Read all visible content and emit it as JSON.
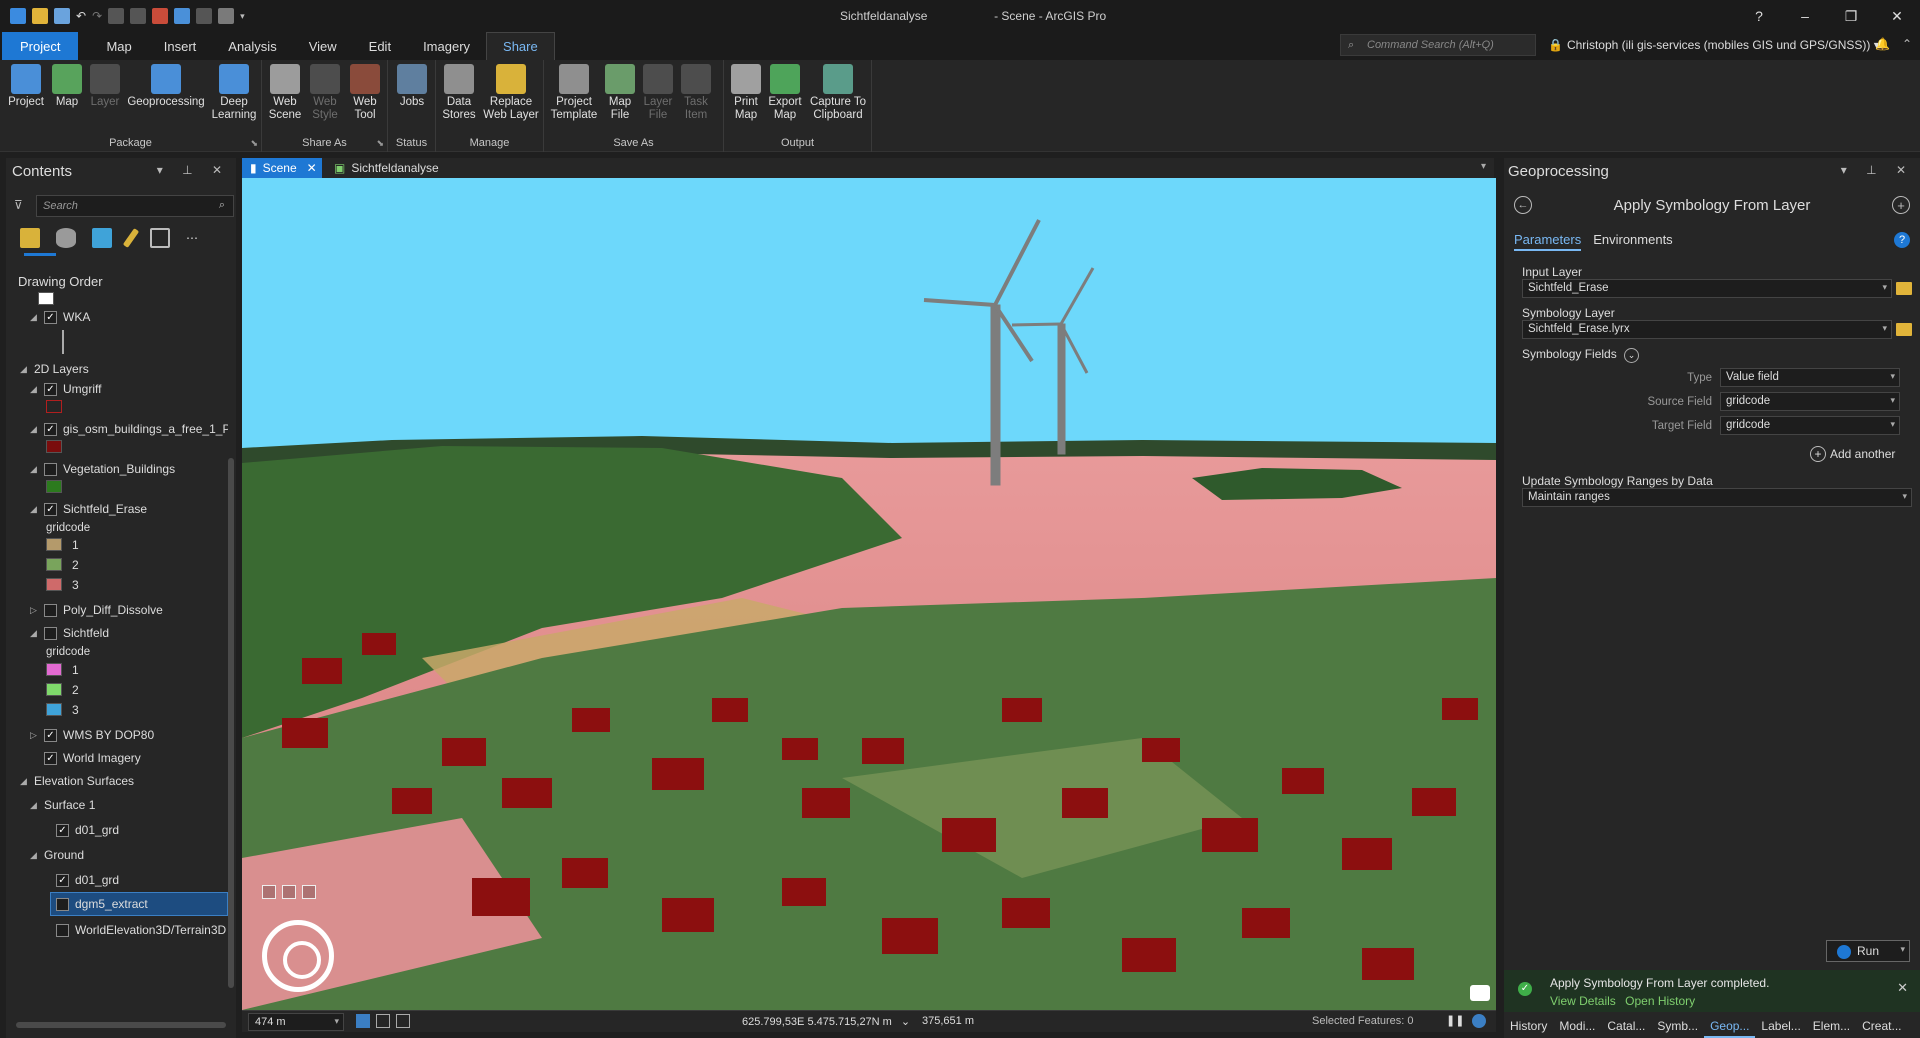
{
  "window": {
    "doc_name": "Sichtfeldanalyse",
    "app_title": "- Scene - ArcGIS Pro",
    "controls": {
      "help": "?",
      "minimize": "–",
      "restore": "❐",
      "close": "✕"
    }
  },
  "ribbon_tabs": [
    "Project",
    "Map",
    "Insert",
    "Analysis",
    "View",
    "Edit",
    "Imagery",
    "Share"
  ],
  "command_search_placeholder": "Command Search (Alt+Q)",
  "user": "Christoph (ili gis-services (mobiles GIS und GPS/GNSS))",
  "ribbon": {
    "groups": [
      "Package",
      "Share As",
      "Status",
      "Manage",
      "Save As",
      "Output"
    ],
    "package": [
      {
        "l1": "Project",
        "l2": ""
      },
      {
        "l1": "Map",
        "l2": ""
      },
      {
        "l1": "Layer",
        "l2": ""
      },
      {
        "l1": "Geoprocessing",
        "l2": ""
      },
      {
        "l1": "Deep",
        "l2": "Learning"
      }
    ],
    "share_as": [
      {
        "l1": "Web",
        "l2": "Scene"
      },
      {
        "l1": "Web",
        "l2": "Style"
      },
      {
        "l1": "Web",
        "l2": "Tool"
      }
    ],
    "status": [
      {
        "l1": "Jobs",
        "l2": ""
      }
    ],
    "manage": [
      {
        "l1": "Data",
        "l2": "Stores"
      },
      {
        "l1": "Replace",
        "l2": "Web Layer"
      }
    ],
    "save_as": [
      {
        "l1": "Project",
        "l2": "Template"
      },
      {
        "l1": "Map",
        "l2": "File"
      },
      {
        "l1": "Layer",
        "l2": "File"
      },
      {
        "l1": "Task",
        "l2": "Item"
      }
    ],
    "output": [
      {
        "l1": "Print",
        "l2": "Map"
      },
      {
        "l1": "Export",
        "l2": "Map"
      },
      {
        "l1": "Capture To",
        "l2": "Clipboard"
      }
    ]
  },
  "contents": {
    "title": "Contents",
    "search_placeholder": "Search",
    "drawing_order": "Drawing Order",
    "items": {
      "wka": "WKA",
      "layers_2d": "2D Layers",
      "umgriff": "Umgriff",
      "osm_buildings": "gis_osm_buildings_a_free_1_P",
      "vegetation": "Vegetation_Buildings",
      "sichtfeld_erase": "Sichtfeld_Erase",
      "gridcode_1": "gridcode",
      "g1_1": "1",
      "g1_2": "2",
      "g1_3": "3",
      "poly_diff": "Poly_Diff_Dissolve",
      "sichtfeld": "Sichtfeld",
      "gridcode_2": "gridcode",
      "g2_1": "1",
      "g2_2": "2",
      "g2_3": "3",
      "wms": "WMS BY DOP80",
      "world_imagery": "World Imagery",
      "elevation": "Elevation Surfaces",
      "surface1": "Surface 1",
      "d01_a": "d01_grd",
      "ground": "Ground",
      "d01_b": "d01_grd",
      "dgm5": "dgm5_extract",
      "world_elev": "WorldElevation3D/Terrain3D"
    },
    "colors": {
      "umgriff": "#b11f1f",
      "osm": "#7a0d0d",
      "veg": "#2c7a1e",
      "se1": "#b49a6b",
      "se2": "#79a45c",
      "se3": "#cf6a6a",
      "sf1": "#e36ad2",
      "sf2": "#7fd96b",
      "sf3": "#3fa3d9"
    }
  },
  "view": {
    "tabs": [
      "Scene",
      "Sichtfeldanalyse"
    ],
    "scale": "474 m",
    "coordinates": "625.799,53E 5.475.715,27N m",
    "distance": "375,651 m",
    "selected_features": "Selected Features: 0"
  },
  "geoprocessing": {
    "title": "Geoprocessing",
    "tool": "Apply Symbology From Layer",
    "tabs": [
      "Parameters",
      "Environments"
    ],
    "input_layer_label": "Input Layer",
    "input_layer_value": "Sichtfeld_Erase",
    "symbology_layer_label": "Symbology Layer",
    "symbology_layer_value": "Sichtfeld_Erase.lyrx",
    "symbology_fields_label": "Symbology Fields",
    "type_label": "Type",
    "type_value": "Value field",
    "source_label": "Source Field",
    "source_value": "gridcode",
    "target_label": "Target Field",
    "target_value": "gridcode",
    "add_another": "Add another",
    "update_label": "Update Symbology Ranges by Data",
    "update_value": "Maintain ranges",
    "run": "Run",
    "notice": "Apply Symbology From Layer completed.",
    "view_details": "View Details",
    "open_history": "Open History",
    "bottom_tabs": [
      "History",
      "Modi...",
      "Catal...",
      "Symb...",
      "Geop...",
      "Label...",
      "Elem...",
      "Creat..."
    ]
  }
}
